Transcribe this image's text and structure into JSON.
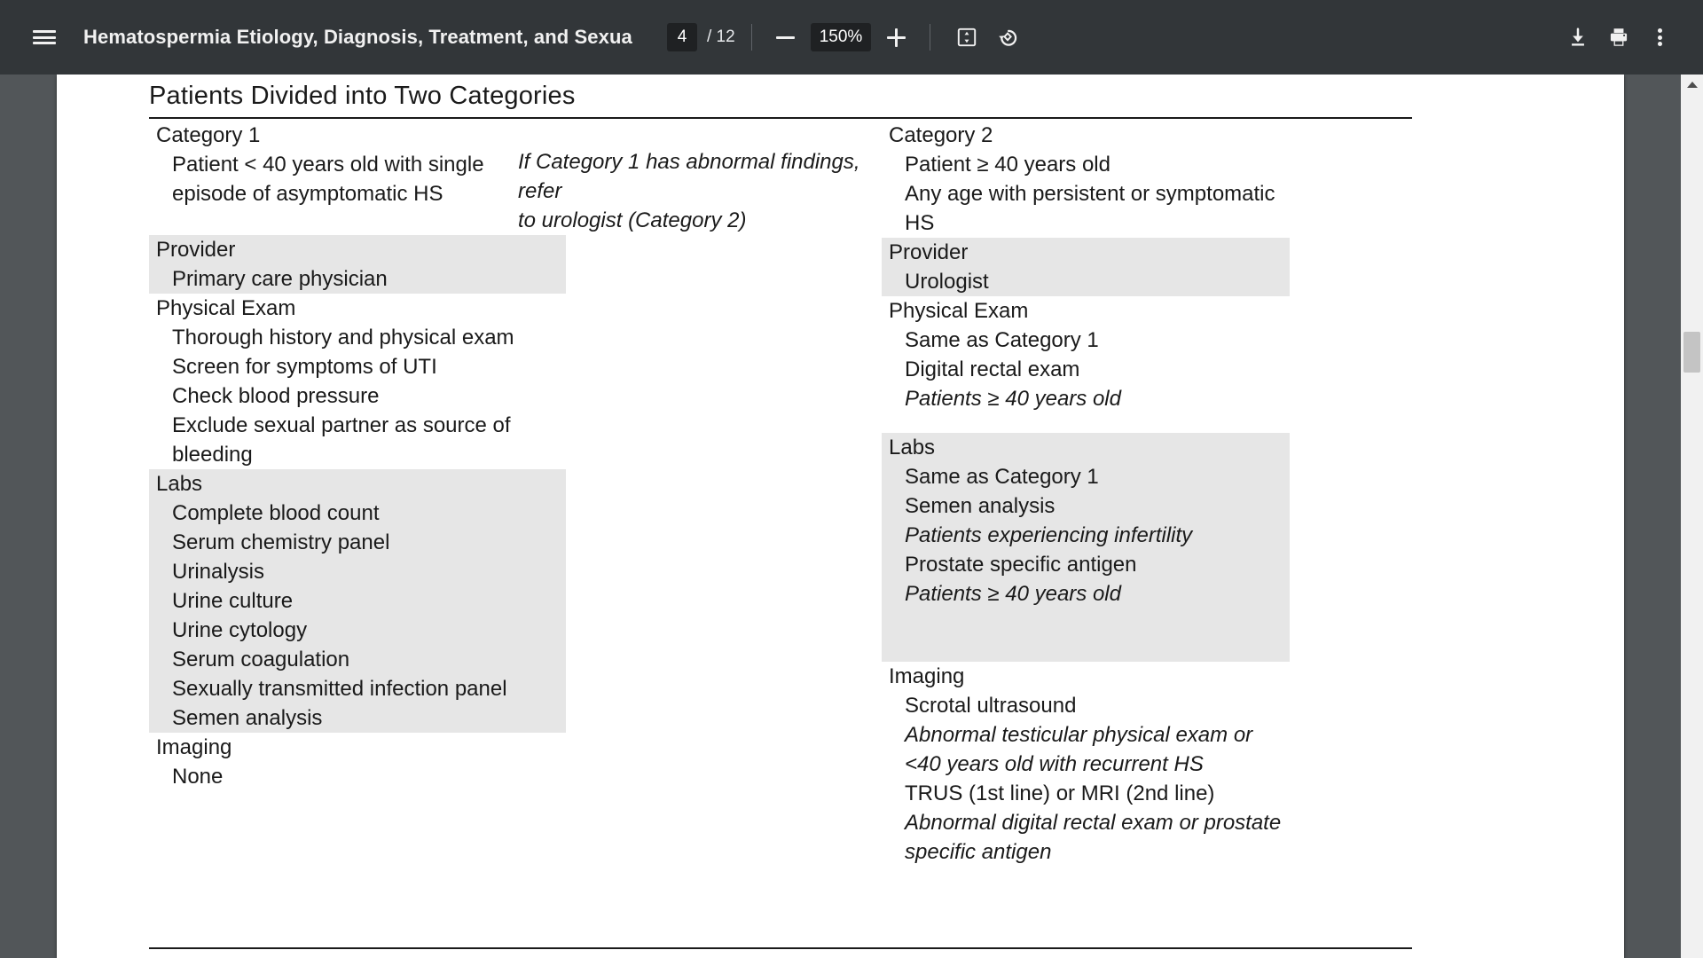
{
  "toolbar": {
    "menu_icon": "hamburger-menu-icon",
    "title": "Hematospermia Etiology, Diagnosis, Treatment, and Sexual Ra…",
    "page_current": "4",
    "page_total": "/ 12",
    "zoom_out_icon": "minus-icon",
    "zoom_level": "150%",
    "zoom_in_icon": "plus-icon",
    "fit_page_icon": "fit-to-page-icon",
    "rotate_icon": "rotate-counterclockwise-icon",
    "download_icon": "download-icon",
    "print_icon": "print-icon",
    "more_icon": "more-vertical-icon"
  },
  "slide": {
    "title": "Patients Divided into Two Categories",
    "left_column": {
      "category_header": "Category 1",
      "category_items": [
        "Patient < 40 years old with single",
        "episode of asymptomatic HS"
      ],
      "sections": [
        {
          "shaded": true,
          "header": "Provider",
          "items": [
            {
              "text": "Primary care physician",
              "italic": false
            }
          ]
        },
        {
          "shaded": false,
          "header": "Physical Exam",
          "items": [
            {
              "text": "Thorough history and physical exam",
              "italic": false
            },
            {
              "text": "Screen for symptoms of UTI",
              "italic": false
            },
            {
              "text": "Check blood pressure",
              "italic": false
            },
            {
              "text": "Exclude sexual partner as source of",
              "italic": false
            },
            {
              "text": "bleeding",
              "italic": false
            }
          ]
        },
        {
          "shaded": true,
          "header": "Labs",
          "items": [
            {
              "text": "Complete blood count",
              "italic": false
            },
            {
              "text": "Serum chemistry panel",
              "italic": false
            },
            {
              "text": "Urinalysis",
              "italic": false
            },
            {
              "text": "Urine culture",
              "italic": false
            },
            {
              "text": "Urine cytology",
              "italic": false
            },
            {
              "text": "Serum coagulation",
              "italic": false
            },
            {
              "text": "Sexually transmitted infection panel",
              "italic": false
            },
            {
              "text": "Semen analysis",
              "italic": false
            }
          ]
        },
        {
          "shaded": false,
          "header": "Imaging",
          "items": [
            {
              "text": "None",
              "italic": false
            }
          ]
        }
      ]
    },
    "middle_column": {
      "note_lines": [
        "If Category 1 has abnormal findings, refer",
        "to urologist (Category 2)"
      ]
    },
    "right_column": {
      "category_header": "Category 2",
      "category_items": [
        "Patient ≥ 40 years old",
        "Any age with persistent or symptomatic",
        "HS"
      ],
      "sections": [
        {
          "shaded": true,
          "header": "Provider",
          "items": [
            {
              "text": "Urologist",
              "italic": false
            }
          ]
        },
        {
          "shaded": false,
          "header": "Physical Exam",
          "items": [
            {
              "text": "Same as Category 1",
              "italic": false
            },
            {
              "text": "Digital rectal exam",
              "italic": false
            },
            {
              "text": "Patients ≥ 40 years old",
              "italic": true
            }
          ]
        },
        {
          "shaded": true,
          "header": "Labs",
          "items": [
            {
              "text": "Same as Category 1",
              "italic": false
            },
            {
              "text": "Semen analysis",
              "italic": false
            },
            {
              "text": "Patients experiencing infertility",
              "italic": true
            },
            {
              "text": "Prostate specific antigen",
              "italic": false
            },
            {
              "text": "Patients ≥ 40 years old",
              "italic": true
            }
          ]
        },
        {
          "shaded": false,
          "header": "Imaging",
          "items": [
            {
              "text": "Scrotal ultrasound",
              "italic": false
            },
            {
              "text": "Abnormal testicular physical exam or",
              "italic": true
            },
            {
              "text": "<40 years old with recurrent HS",
              "italic": true
            },
            {
              "text": "TRUS (1st line) or MRI (2nd line)",
              "italic": false
            },
            {
              "text": "Abnormal digital rectal exam or prostate",
              "italic": true
            },
            {
              "text": "specific antigen",
              "italic": true
            }
          ]
        }
      ]
    }
  },
  "scrollbar": {
    "up_arrow_icon": "scroll-up-arrow-icon",
    "thumb": "scroll-thumb"
  },
  "colors": {
    "toolbar_bg": "#323639",
    "viewer_bg": "#525659",
    "page_bg": "#ffffff",
    "shaded_block": "#e6e6e6",
    "text": "#141414"
  }
}
